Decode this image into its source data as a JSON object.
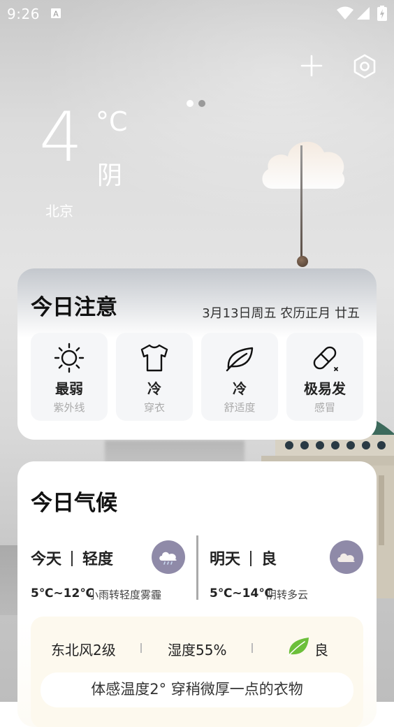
{
  "status_bar": {
    "time": "9:26"
  },
  "header": {
    "add_icon": "plus-icon",
    "settings_icon": "settings-icon",
    "pages": 2,
    "current_page": 1
  },
  "current": {
    "temperature": "4",
    "unit": "°C",
    "condition": "阴",
    "city": "北京"
  },
  "notice": {
    "title": "今日注意",
    "date": "3月13日周五 农历正月 廿五",
    "items": [
      {
        "icon": "sun-icon",
        "value": "最弱",
        "label": "紫外线"
      },
      {
        "icon": "shirt-icon",
        "value": "冷",
        "label": "穿衣"
      },
      {
        "icon": "leaf-icon",
        "value": "冷",
        "label": "舒适度"
      },
      {
        "icon": "pill-icon",
        "value": "极易发",
        "label": "感冒"
      }
    ]
  },
  "climate": {
    "title": "今日气候",
    "today": {
      "day": "今天",
      "aqi": "轻度",
      "range": "5℃~12℃",
      "desc": "小雨转轻度雾霾",
      "icon": "rain-cloud-icon"
    },
    "tomorrow": {
      "day": "明天",
      "aqi": "良",
      "range": "5℃~14℃",
      "desc": "阴转多云",
      "icon": "cloud-icon"
    },
    "details": {
      "wind": "东北风2级",
      "humidity": "湿度55%",
      "air": "良",
      "air_icon": "leaf-icon"
    },
    "feel": "体感温度2° 穿稍微厚一点的衣物"
  },
  "colors": {
    "accent_icon_bg": "#8f8aa8",
    "leaf_green": "#6cbf3a"
  }
}
